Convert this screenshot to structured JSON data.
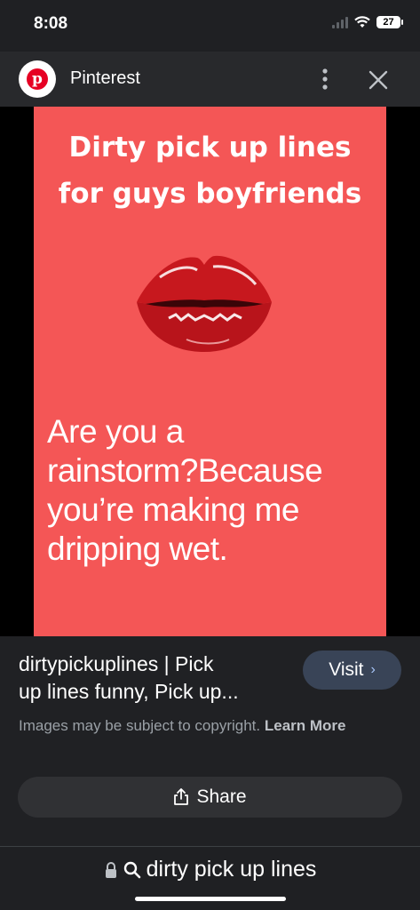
{
  "status_bar": {
    "time": "8:08",
    "battery": "27"
  },
  "header": {
    "title": "Pinterest",
    "logo_letter": "p"
  },
  "pin": {
    "title_line1": "Dirty pick up lines",
    "title_line2": "for guys boyfriends",
    "body_line1": "Are you a",
    "body_line2": "rainstorm?Because",
    "body_line3": "you’re making me",
    "body_line4": "dripping wet.",
    "background_color": "#f45656"
  },
  "info": {
    "link_line1": "dirtypickuplines | Pick",
    "link_line2": "up lines funny, Pick up...",
    "visit_label": "Visit",
    "copyright_text": "Images may be subject to copyright.",
    "learn_more": "Learn More",
    "share_label": "Share"
  },
  "search": {
    "query": "dirty pick up lines"
  }
}
